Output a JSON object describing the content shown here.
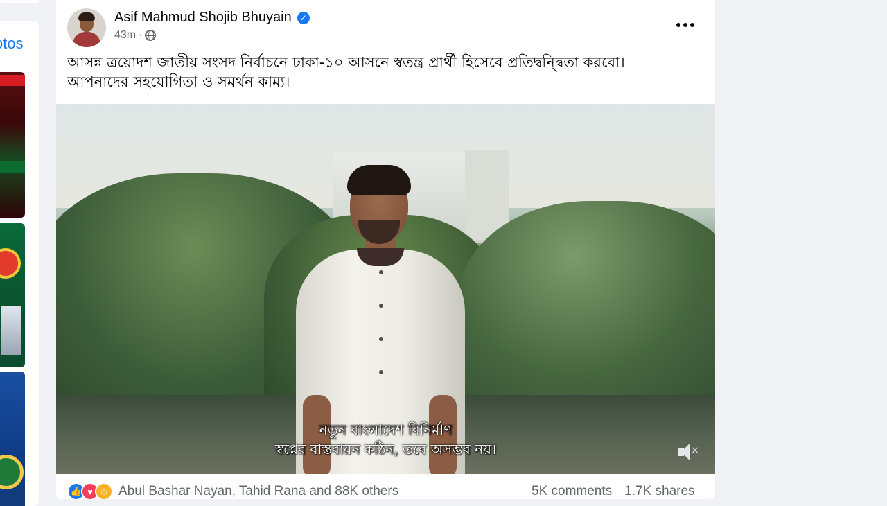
{
  "left_panel": {
    "photos_link": "otos"
  },
  "post": {
    "author": "Asif Mahmud Shojib Bhuyain",
    "time": "43m",
    "caption_lines": [
      "আসন্ন ত্রয়োদশ জাতীয় সংসদ নির্বাচনে ঢাকা-১০ আসনে স্বতন্ত্র প্রার্থী হিসেবে প্রতিদ্বন্দ্বিতা করবো।",
      "আপনাদের সহযোগিতা ও সমর্থন কাম্য।"
    ],
    "video": {
      "subtitle_lines": [
        "নতুন বাংলাদেশ বিনির্মাণ",
        "স্বপ্নের বাস্তবায়ন কঠিন, তবে অসম্ভব নয়।"
      ],
      "mute_mark": "×"
    },
    "reactions": {
      "icons": [
        "like-icon",
        "love-icon",
        "care-icon"
      ],
      "summary": "Abul Bashar Nayan, Tahid Rana and 88K others"
    },
    "comments": "5K comments",
    "shares": "1.7K shares"
  },
  "colors": {
    "accent": "#1877f2",
    "secondary_text": "#65676b",
    "background": "#f0f2f5"
  }
}
